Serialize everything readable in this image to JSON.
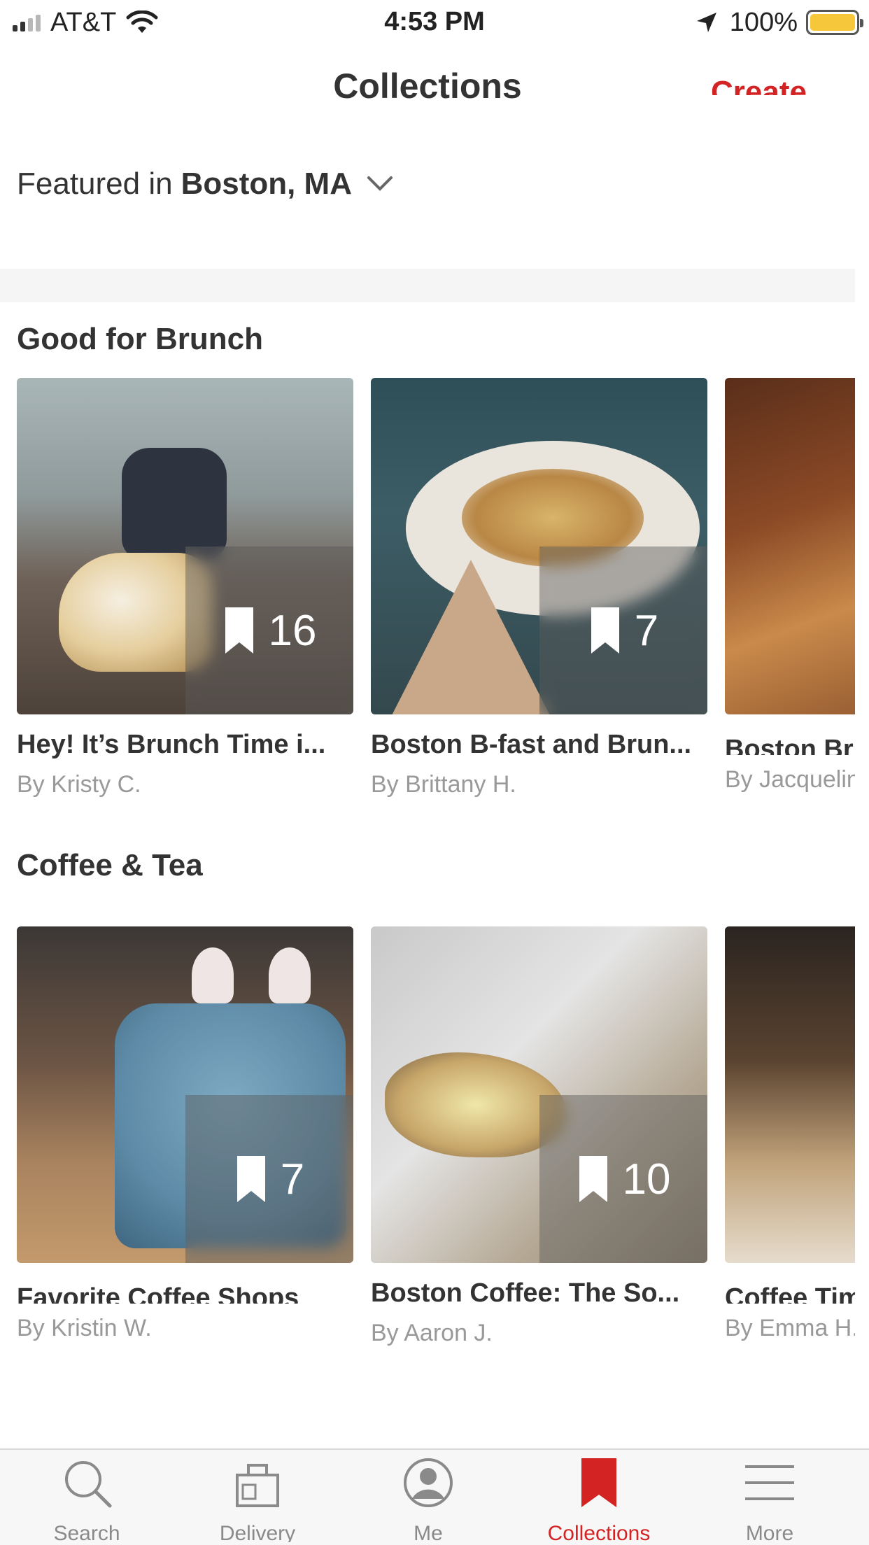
{
  "status_bar": {
    "carrier": "AT&T",
    "time": "4:53 PM",
    "battery": "100%"
  },
  "header": {
    "title": "Collections",
    "create_label": "Create"
  },
  "featured": {
    "prefix": "Featured in",
    "city": "Boston, MA"
  },
  "sections": [
    {
      "title": "Good for Brunch",
      "cards": [
        {
          "title": "Hey! It’s Brunch Time i...",
          "author": "By Kristy C.",
          "count": "16"
        },
        {
          "title": "Boston B-fast and Brun...",
          "author": "By Brittany H.",
          "count": "7"
        },
        {
          "title": "Boston Bru",
          "author": "By Jacquelin"
        }
      ]
    },
    {
      "title": "Coffee & Tea",
      "cards": [
        {
          "title": "Favorite Coffee Shops",
          "author": "By Kristin W.",
          "count": "7"
        },
        {
          "title": "Boston Coffee: The So...",
          "author": "By Aaron J.",
          "count": "10"
        },
        {
          "title": "Coffee Tim",
          "author": "By Emma H."
        }
      ]
    }
  ],
  "tabs": [
    {
      "label": "Search",
      "icon": "search-icon"
    },
    {
      "label": "Delivery",
      "icon": "delivery-bag-icon"
    },
    {
      "label": "Me",
      "icon": "profile-icon"
    },
    {
      "label": "Collections",
      "icon": "bookmark-icon",
      "active": true
    },
    {
      "label": "More",
      "icon": "menu-icon"
    }
  ],
  "colors": {
    "brand": "#d32323",
    "battery": "#f6c73a",
    "text": "#333333",
    "muted": "#999999"
  }
}
